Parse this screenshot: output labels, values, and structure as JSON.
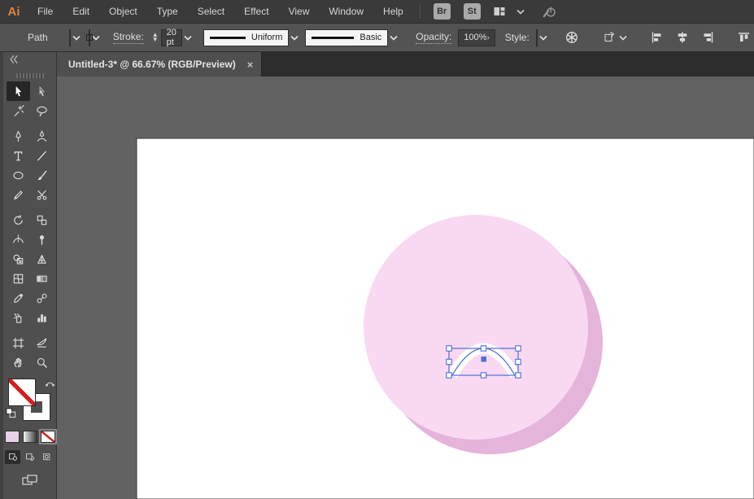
{
  "app": {
    "logo_text": "Ai"
  },
  "menubar": {
    "menus": [
      "File",
      "Edit",
      "Object",
      "Type",
      "Select",
      "Effect",
      "View",
      "Window",
      "Help"
    ],
    "bridge_button": "Br",
    "stock_button": "St"
  },
  "controlbar": {
    "selection_type": "Path",
    "stroke_label": "Stroke:",
    "stroke_weight": "20 pt",
    "width_profile": "Uniform",
    "brush": "Basic",
    "opacity_label": "Opacity:",
    "opacity_value": "100%",
    "opacity_expander": "›",
    "style_label": "Style:"
  },
  "document_tab": {
    "title": "Untitled-3* @ 66.67% (RGB/Preview)",
    "close_glyph": "×"
  },
  "toolbar": {
    "tools": [
      {
        "name": "selection",
        "active": true
      },
      {
        "name": "direct-selection",
        "active": false
      },
      {
        "name": "magic-wand",
        "active": false
      },
      {
        "name": "lasso",
        "active": false
      },
      {
        "name": "pen",
        "active": false
      },
      {
        "name": "curvature",
        "active": false
      },
      {
        "name": "type",
        "active": false
      },
      {
        "name": "line-segment",
        "active": false
      },
      {
        "name": "ellipse",
        "active": false
      },
      {
        "name": "paintbrush",
        "active": false
      },
      {
        "name": "shaper",
        "active": false
      },
      {
        "name": "scissors",
        "active": false
      },
      {
        "name": "rotate",
        "active": false
      },
      {
        "name": "scale",
        "active": false
      },
      {
        "name": "width",
        "active": false
      },
      {
        "name": "puppet-warp",
        "active": false
      },
      {
        "name": "shape-builder",
        "active": false
      },
      {
        "name": "perspective-grid",
        "active": false
      },
      {
        "name": "mesh",
        "active": false
      },
      {
        "name": "gradient",
        "active": false
      },
      {
        "name": "eyedropper",
        "active": false
      },
      {
        "name": "blend",
        "active": false
      },
      {
        "name": "symbol-sprayer",
        "active": false
      },
      {
        "name": "column-graph",
        "active": false
      },
      {
        "name": "artboard",
        "active": false
      },
      {
        "name": "slice",
        "active": false
      },
      {
        "name": "hand",
        "active": false
      },
      {
        "name": "zoom",
        "active": false
      }
    ],
    "gap_after_rows": [
      1,
      5,
      11
    ],
    "fill_mode": "none",
    "active_paint_button": "none",
    "active_draw_mode": "draw-normal"
  },
  "canvas": {
    "artboard_color": "#ffffff",
    "pasteboard_color": "#626262",
    "ball_color": "#f9d9f2",
    "ball_shadow_color": "#e5b4da",
    "arc_fill_color": "#ffffff",
    "selection_color": "#4a6fd8"
  },
  "colors": {
    "accent_orange": "#e0823c",
    "ui_dark": "#3a3a3a",
    "ui_mid": "#535353",
    "slash_red": "#d21f1f"
  }
}
